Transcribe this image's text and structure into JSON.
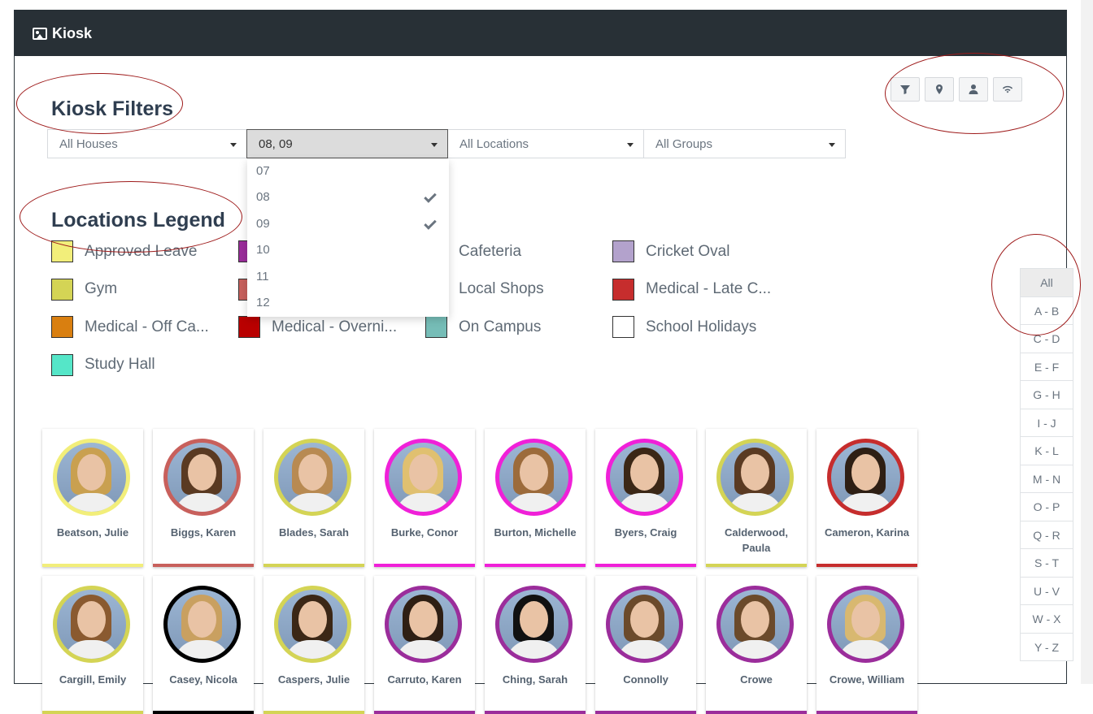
{
  "app": {
    "title": "Kiosk"
  },
  "headings": {
    "filters": "Kiosk Filters",
    "legend": "Locations Legend"
  },
  "filters": {
    "houses": "All Houses",
    "years": "08, 09",
    "locations": "All Locations",
    "groups": "All Groups"
  },
  "dropdown": [
    {
      "label": "07",
      "checked": false
    },
    {
      "label": "08",
      "checked": true
    },
    {
      "label": "09",
      "checked": true
    },
    {
      "label": "10",
      "checked": false
    },
    {
      "label": "11",
      "checked": false
    },
    {
      "label": "12",
      "checked": false
    }
  ],
  "toolbar_icons": [
    "filter-icon",
    "map-marker-icon",
    "user-icon",
    "wifi-icon"
  ],
  "legend": [
    {
      "label": "Approved Leave",
      "color": "#f2ee7a"
    },
    {
      "label": "",
      "color": "#9b2d9b"
    },
    {
      "label": "Cafeteria",
      "color": ""
    },
    {
      "label": "Cricket Oval",
      "color": "#b3a2cc"
    },
    {
      "label": "Gym",
      "color": "#d4d455"
    },
    {
      "label": "",
      "color": "#c8605c"
    },
    {
      "label": "Local Shops",
      "color": ""
    },
    {
      "label": "Medical - Late C...",
      "color": "#c62d2d"
    },
    {
      "label": "Medical - Off Ca...",
      "color": "#d97f10"
    },
    {
      "label": "Medical - Overni...",
      "color": "#b90000"
    },
    {
      "label": "On Campus",
      "color": "#76bdb7"
    },
    {
      "label": "School Holidays",
      "color": "#ffffff"
    },
    {
      "label": "Study Hall",
      "color": "#55e6c8"
    }
  ],
  "alphabet": [
    "All",
    "A - B",
    "C - D",
    "E - F",
    "G - H",
    "I - J",
    "K - L",
    "M - N",
    "O - P",
    "Q - R",
    "S - T",
    "U - V",
    "W - X",
    "Y - Z"
  ],
  "students": [
    {
      "name": "Beatson, Julie",
      "color": "#f2ee7a"
    },
    {
      "name": "Biggs, Karen",
      "color": "#c8605c"
    },
    {
      "name": "Blades, Sarah",
      "color": "#d4d455"
    },
    {
      "name": "Burke, Conor",
      "color": "#f020d8"
    },
    {
      "name": "Burton, Michelle",
      "color": "#f020d8"
    },
    {
      "name": "Byers, Craig",
      "color": "#f020d8"
    },
    {
      "name": "Calderwood, Paula",
      "color": "#d4d455"
    },
    {
      "name": "Cameron, Karina",
      "color": "#c62d2d"
    },
    {
      "name": "Cargill, Emily",
      "color": "#d4d455"
    },
    {
      "name": "Casey, Nicola",
      "color": "#000000"
    },
    {
      "name": "Caspers, Julie",
      "color": "#d4d455"
    },
    {
      "name": "Carruto, Karen",
      "color": "#9b2d9b"
    },
    {
      "name": "Ching, Sarah",
      "color": "#9b2d9b"
    },
    {
      "name": "Connolly",
      "color": "#9b2d9b"
    },
    {
      "name": "Crowe",
      "color": "#9b2d9b"
    },
    {
      "name": "Crowe, William",
      "color": "#9b2d9b"
    }
  ]
}
